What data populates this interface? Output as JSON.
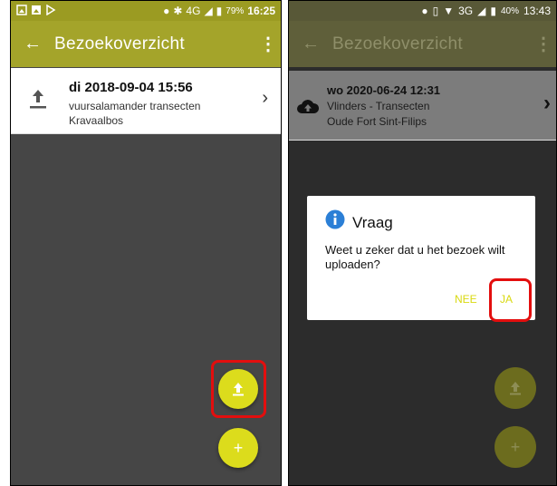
{
  "left_screen": {
    "status": {
      "battery": "79%",
      "time": "16:25",
      "network": "4G"
    },
    "appbar": {
      "back": "←",
      "title": "Bezoekoverzicht",
      "menu": "⋮"
    },
    "visit": {
      "date": "di  2018-09-04  15:56",
      "line1": "vuursalamander transecten",
      "line2": "Kravaalbos",
      "chevron": "›",
      "icon": "upload-icon"
    },
    "fab_upload": {
      "label": "⭱",
      "icon": "upload-icon"
    },
    "fab_add": {
      "label": "+"
    }
  },
  "right_screen": {
    "status": {
      "battery": "40%",
      "time": "13:43",
      "network": "3G"
    },
    "appbar": {
      "back": "←",
      "title": "Bezoekoverzicht",
      "menu": "⋮"
    },
    "visit": {
      "date": "wo  2020-06-24  12:31",
      "line1": "Vlinders - Transecten",
      "line2": "Oude Fort Sint-Filips",
      "chevron": "›",
      "icon": "cloud-upload-icon"
    },
    "dialog": {
      "title": "Vraag",
      "message": "Weet u zeker dat u het bezoek wilt uploaden?",
      "no_label": "NEE",
      "yes_label": "JA",
      "icon": "info-icon"
    },
    "fab_upload": {
      "label": "⭱"
    },
    "fab_add": {
      "label": "+"
    }
  },
  "colors": {
    "appbar": "#a4a42a",
    "fab": "#dcdc1c",
    "highlight": "#e30e0e",
    "info_blue": "#2b7fd6"
  }
}
